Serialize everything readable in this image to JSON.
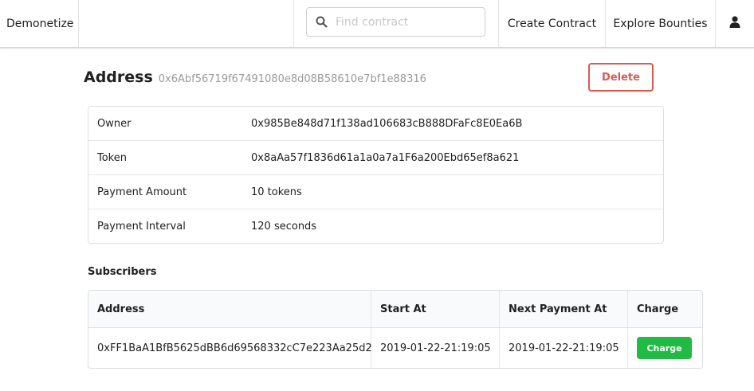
{
  "navbar": {
    "brand": "Demonetize",
    "search_placeholder": "Find contract",
    "create_contract": "Create Contract",
    "explore_bounties": "Explore Bounties",
    "user_icon": "user-icon"
  },
  "header": {
    "label": "Address",
    "address": "0x6Abf56719f67491080e8d08B58610e7bf1e88316",
    "delete_label": "Delete"
  },
  "details": [
    {
      "label": "Owner",
      "value": "0x985Be848d71f138ad106683cB888DFaFc8E0Ea6B"
    },
    {
      "label": "Token",
      "value": "0x8aAa57f1836d61a1a0a7a1F6a200Ebd65ef8a621"
    },
    {
      "label": "Payment Amount",
      "value": "10 tokens"
    },
    {
      "label": "Payment Interval",
      "value": "120 seconds"
    }
  ],
  "subscribers": {
    "heading": "Subscribers",
    "columns": [
      "Address",
      "Start At",
      "Next Payment At",
      "Charge"
    ],
    "rows": [
      {
        "address": "0xFF1BaA1BfB5625dBB6d69568332cC7e223Aa25d2",
        "start_at": "2019-01-22-21:19:05",
        "next_payment_at": "2019-01-22-21:19:05",
        "charge_label": "Charge"
      }
    ]
  },
  "colors": {
    "delete": "#db5a50",
    "charge": "#21ba45"
  }
}
